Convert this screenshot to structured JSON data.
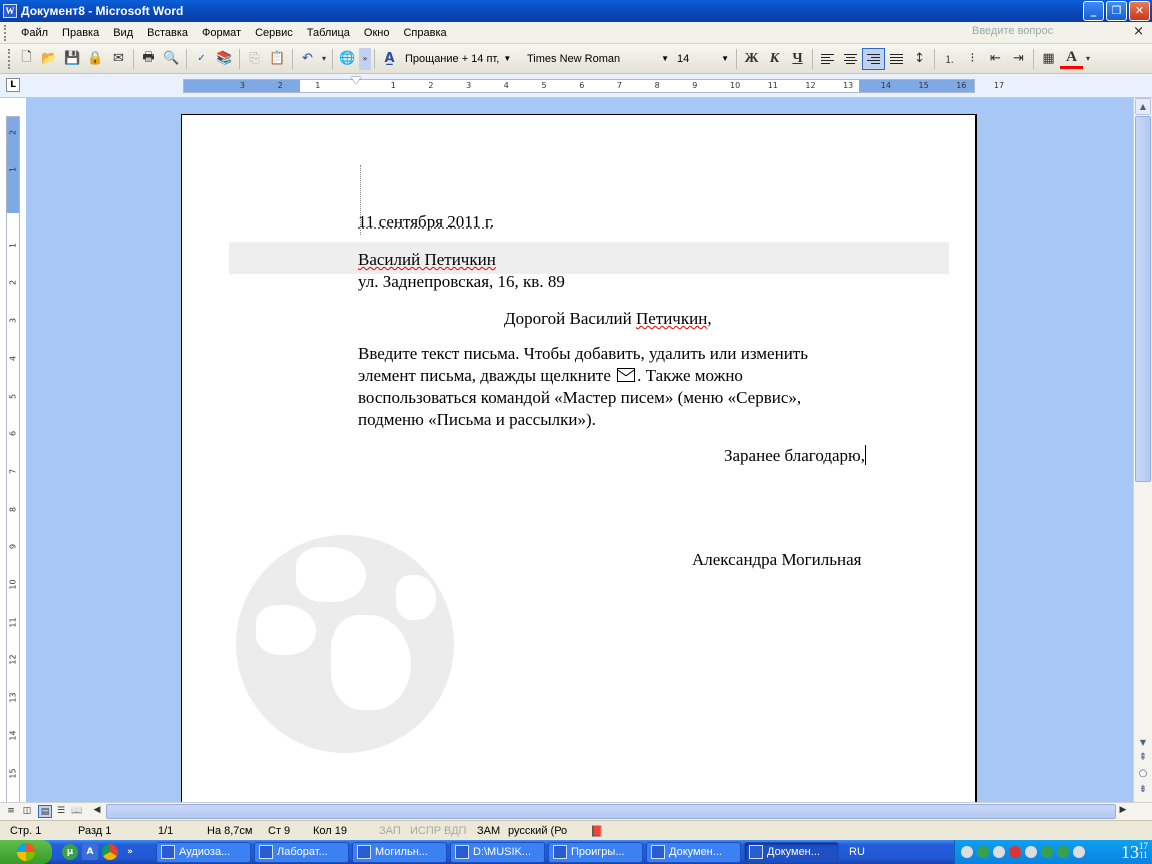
{
  "window": {
    "title": "Документ8 - Microsoft Word",
    "app_icon": "W"
  },
  "menu": {
    "items": [
      "Файл",
      "Правка",
      "Вид",
      "Вставка",
      "Формат",
      "Сервис",
      "Таблица",
      "Окно",
      "Справка"
    ],
    "ask_placeholder": "Введите вопрос"
  },
  "toolbar": {
    "style": "Прощание + 14 пт,",
    "font": "Times New Roman",
    "size": "14",
    "bold": "Ж",
    "italic": "К",
    "underline": "Ч",
    "font_color": "#ff0000"
  },
  "ruler": {
    "h_ticks": [
      "3",
      "2",
      "1",
      "1",
      "2",
      "3",
      "4",
      "5",
      "6",
      "7",
      "8",
      "9",
      "10",
      "11",
      "12",
      "13",
      "14",
      "15",
      "16",
      "17"
    ],
    "v_ticks": [
      "2",
      "1",
      "1",
      "2",
      "3",
      "4",
      "5",
      "6",
      "7",
      "8",
      "9",
      "10",
      "11",
      "12",
      "13",
      "14",
      "15"
    ]
  },
  "letter": {
    "date": "11 сентября 2011 г.",
    "recipient_name": "Василий Петичкин",
    "recipient_address": "ул. Заднепровская, 16, кв. 89",
    "salutation_prefix": "Дорогой Василий ",
    "salutation_name": "Петичкин",
    "salutation_suffix": ",",
    "body_line1": "Введите текст письма. Чтобы добавить, удалить или изменить",
    "body_line2a": "элемент письма, дважды щелкните",
    "body_line2b": ".  Также можно",
    "body_line3": "воспользоваться командой «Мастер писем» (меню «Сервис»,",
    "body_line4": "подменю «Письма и рассылки»).",
    "closing": "Заранее благодарю,",
    "signature": "Александра Могильная"
  },
  "status": {
    "page": "Стр.  1",
    "section": "Разд  1",
    "pages": "1/1",
    "at": "На  8,7см",
    "line": "Ст  9",
    "col": "Кол  19",
    "rec": "ЗАП",
    "trk": "ИСПР",
    "ext": "ВДП",
    "ovr": "ЗАМ",
    "lang": "русский (Ро"
  },
  "taskbar": {
    "tasks": [
      "Аудиоза...",
      "Лаборат...",
      "Могильн...",
      "D:\\MUSIK...",
      "Проигры...",
      "Докумен...",
      "Докумен..."
    ],
    "active_task": 6,
    "language": "RU",
    "clock_hour": "13",
    "clock_min_top": "17",
    "clock_min_bottom": "11"
  }
}
